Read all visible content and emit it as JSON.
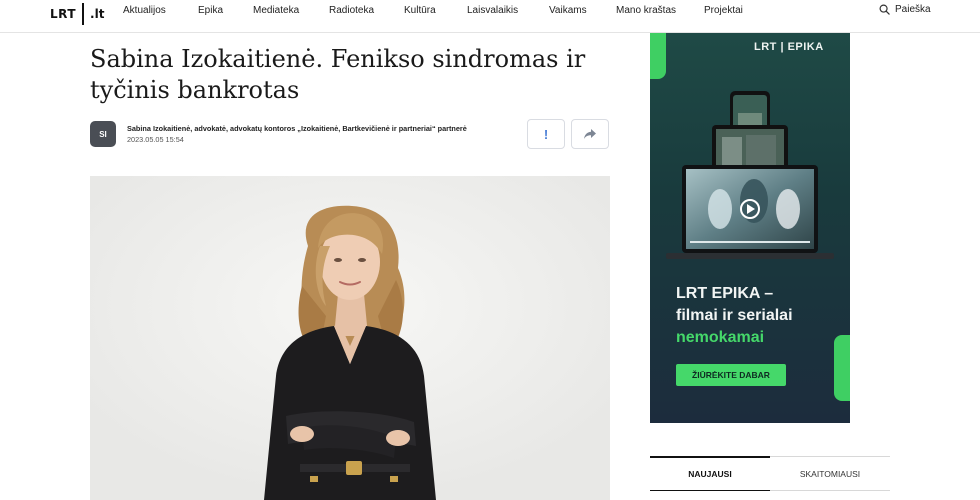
{
  "header": {
    "logo_left": "LRT",
    "logo_right": ".lt",
    "nav": [
      {
        "label": "Aktualijos"
      },
      {
        "label": "Epika"
      },
      {
        "label": "Mediateka"
      },
      {
        "label": "Radioteka"
      },
      {
        "label": "Kultūra"
      },
      {
        "label": "Laisvalaikis"
      },
      {
        "label": "Vaikams"
      },
      {
        "label": "Mano kraštas"
      },
      {
        "label": "Projektai"
      }
    ],
    "search_label": "Paieška"
  },
  "article": {
    "title": "Sabina Izokaitienė. Fenikso sindromas ir tyčinis bankrotas",
    "author_initials": "SI",
    "author": "Sabina Izokaitienė, advokatė, advokatų kontoros „Izokaitienė, Bartkevičienė ir partneriai“ partnerė",
    "date": "2023.05.05 15:54",
    "report_icon": "!",
    "share_icon": "share-arrow"
  },
  "ad": {
    "brand": "LRT | EPIKA",
    "headline_line1": "LRT EPIKA –",
    "headline_line2": "filmai ir serialai",
    "headline_highlight": "nemokamai",
    "cta": "ŽIŪRĖKITE DABAR",
    "accent_color": "#45d86a"
  },
  "tabs": [
    {
      "label": "NAUJAUSI"
    },
    {
      "label": "SKAITOMIAUSI"
    }
  ]
}
